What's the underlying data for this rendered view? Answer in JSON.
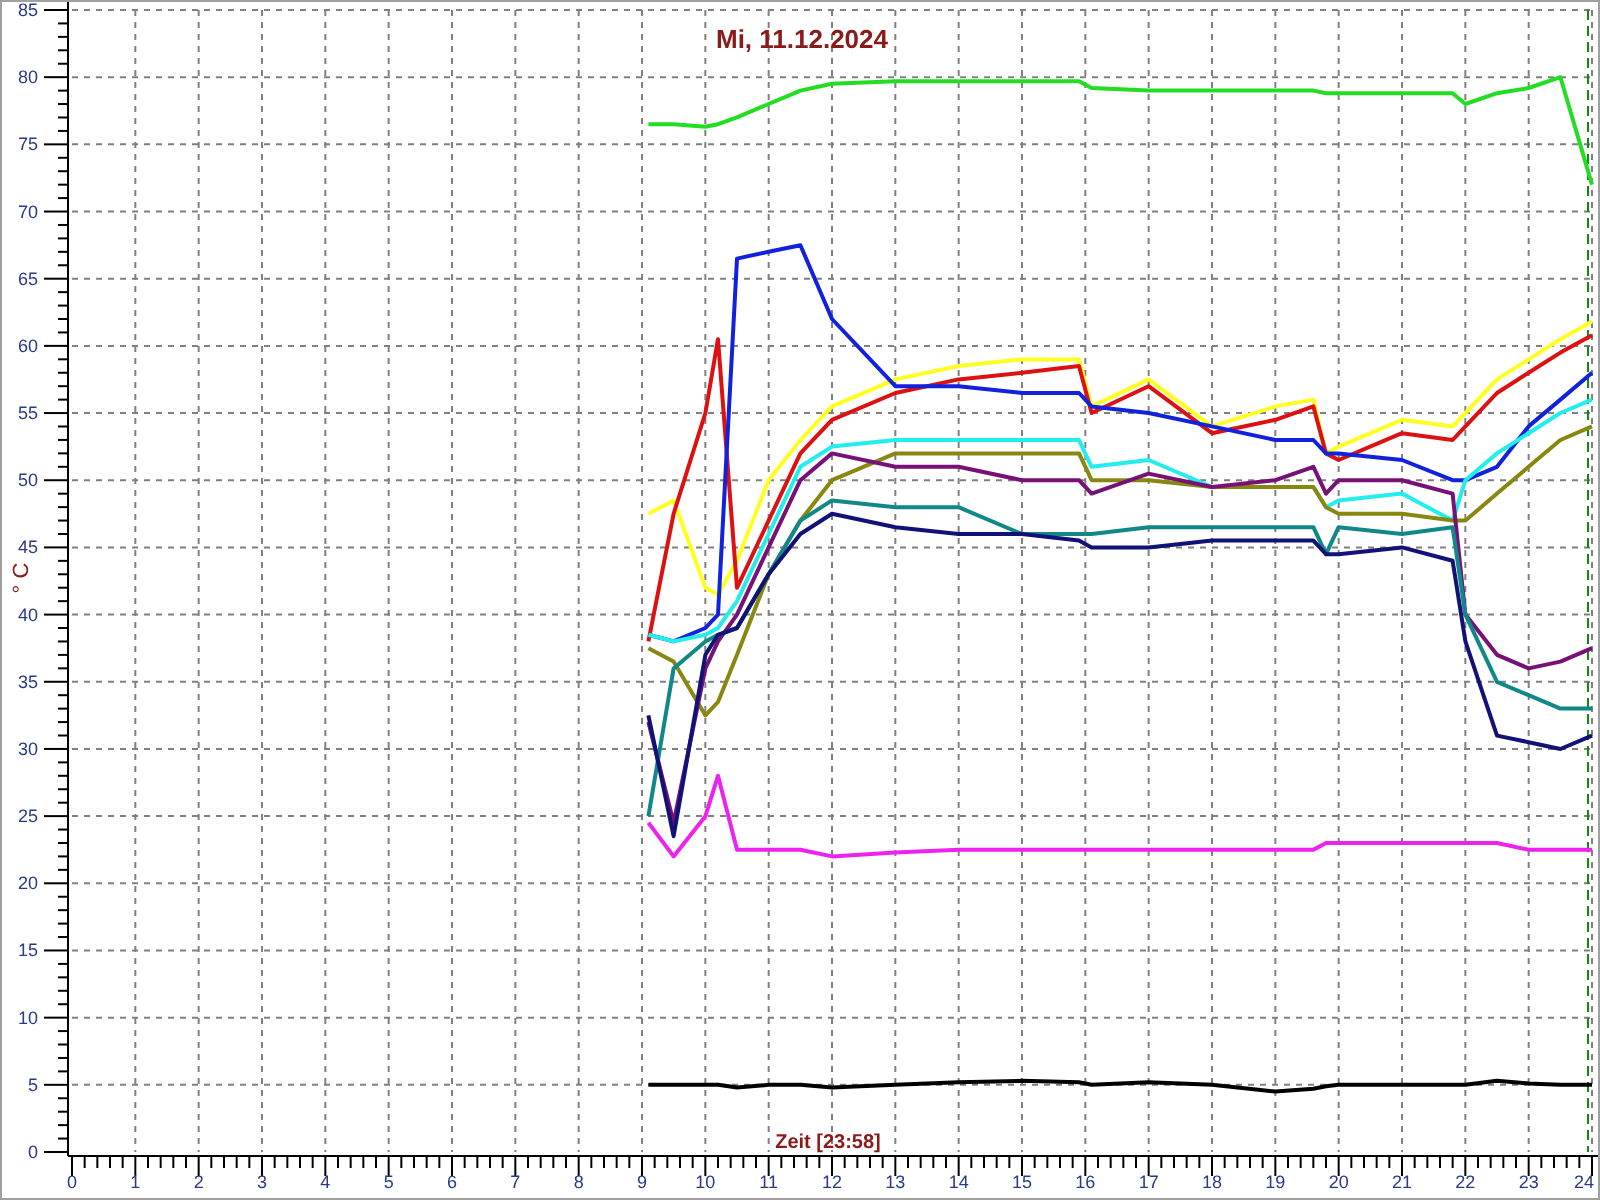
{
  "chart_data": {
    "type": "line",
    "grid": true,
    "title": "Mi, 11.12.2024",
    "xlabel": "Zeit [23:58]",
    "ylabel": "° C",
    "xlim": [
      0,
      24
    ],
    "ylim": [
      0,
      85
    ],
    "xticks": [
      0,
      1,
      2,
      3,
      4,
      5,
      6,
      7,
      8,
      9,
      10,
      11,
      12,
      13,
      14,
      15,
      16,
      17,
      18,
      19,
      20,
      21,
      22,
      23,
      24
    ],
    "yticks": [
      0,
      5,
      10,
      15,
      20,
      25,
      30,
      35,
      40,
      45,
      50,
      55,
      60,
      65,
      70,
      75,
      80,
      85
    ],
    "x": [
      9.1,
      9.5,
      10,
      10.2,
      10.5,
      11,
      11.5,
      12,
      13,
      14,
      15,
      15.9,
      16.1,
      17,
      18,
      19,
      19.6,
      19.8,
      20,
      21,
      21.8,
      22,
      22.5,
      23,
      23.5,
      24
    ],
    "series": [
      {
        "color": "#22dd22",
        "values": [
          76.5,
          76.5,
          76.3,
          76.5,
          77,
          78,
          79,
          79.5,
          79.7,
          79.7,
          79.7,
          79.7,
          79.2,
          79,
          79,
          79,
          79,
          78.8,
          78.8,
          78.8,
          78.8,
          78,
          78.8,
          79.2,
          80,
          72
        ]
      },
      {
        "color": "#ffff22",
        "values": [
          47.5,
          48.5,
          42,
          41.5,
          44,
          50,
          53,
          55.5,
          57.5,
          58.5,
          59,
          59,
          55.5,
          57.5,
          54,
          55.5,
          56,
          52,
          52.5,
          54.5,
          54,
          55,
          57.5,
          59,
          60.5,
          61.8
        ]
      },
      {
        "color": "#dd1111",
        "values": [
          38,
          47.5,
          55,
          60.5,
          42,
          47,
          52,
          54.5,
          56.5,
          57.5,
          58,
          58.5,
          55,
          57,
          53.5,
          54.5,
          55.5,
          52,
          51.5,
          53.5,
          53,
          54,
          56.5,
          58,
          59.5,
          60.8
        ]
      },
      {
        "color": "#1122dd",
        "values": [
          38.5,
          38,
          39,
          40,
          66.5,
          67,
          67.5,
          62,
          57,
          57,
          56.5,
          56.5,
          55.5,
          55,
          54,
          53,
          53,
          52,
          52,
          51.5,
          50,
          50,
          51,
          54,
          56,
          58
        ]
      },
      {
        "color": "#22eeee",
        "values": [
          38.5,
          38,
          38.5,
          39,
          41,
          46,
          51,
          52.5,
          53,
          53,
          53,
          53,
          51,
          51.5,
          49.5,
          49.5,
          49.5,
          48,
          48.5,
          49,
          47,
          50,
          52,
          53.5,
          55,
          56
        ]
      },
      {
        "color": "#888811",
        "values": [
          37.5,
          36.5,
          32.5,
          33.5,
          37,
          43,
          47,
          50,
          52,
          52,
          52,
          52,
          50,
          50,
          49.5,
          49.5,
          49.5,
          48,
          47.5,
          47.5,
          47,
          47,
          49,
          51,
          53,
          54
        ]
      },
      {
        "color": "#771177",
        "values": [
          32,
          24.5,
          36,
          38,
          40,
          45,
          50,
          52,
          51,
          51,
          50,
          50,
          49,
          50.5,
          49.5,
          50,
          51,
          49,
          50,
          50,
          49,
          40,
          37,
          36,
          36.5,
          37.5
        ]
      },
      {
        "color": "#118888",
        "values": [
          25,
          36,
          38,
          38.5,
          39,
          43,
          47,
          48.5,
          48,
          48,
          46,
          46,
          46,
          46.5,
          46.5,
          46.5,
          46.5,
          44.5,
          46.5,
          46,
          46.5,
          40,
          35,
          34,
          33,
          33
        ]
      },
      {
        "color": "#111177",
        "values": [
          32.5,
          23.5,
          37,
          38.5,
          39,
          43,
          46,
          47.5,
          46.5,
          46,
          46,
          45.5,
          45,
          45,
          45.5,
          45.5,
          45.5,
          44.5,
          44.5,
          45,
          44,
          38,
          31,
          30.5,
          30,
          31
        ]
      },
      {
        "color": "#ee22ee",
        "values": [
          24.5,
          22,
          25,
          28,
          22.5,
          22.5,
          22.5,
          22,
          22.3,
          22.5,
          22.5,
          22.5,
          22.5,
          22.5,
          22.5,
          22.5,
          22.5,
          23,
          23,
          23,
          23,
          23,
          23,
          22.5,
          22.5,
          22.5
        ]
      },
      {
        "color": "#000000",
        "values": [
          5,
          5,
          5,
          5,
          4.8,
          5,
          5,
          4.8,
          5,
          5.2,
          5.3,
          5.2,
          5,
          5.2,
          5,
          4.5,
          4.7,
          4.9,
          5,
          5,
          5,
          5,
          5.3,
          5.1,
          5,
          5
        ]
      }
    ]
  }
}
